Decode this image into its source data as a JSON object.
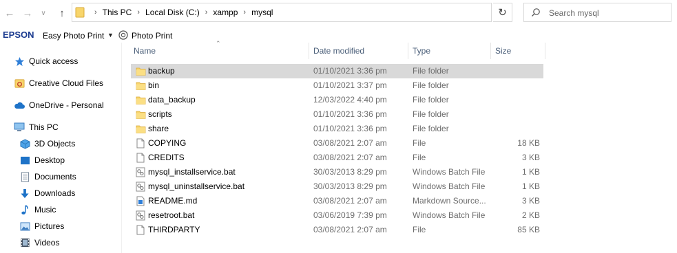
{
  "address_bar": {
    "crumbs": [
      "This PC",
      "Local Disk (C:)",
      "xampp",
      "mysql"
    ],
    "search_placeholder": "Search mysql"
  },
  "epson_toolbar": {
    "logo": "EPSON",
    "easy_photo_print": "Easy Photo Print",
    "photo_print": "Photo Print"
  },
  "sidebar": {
    "items": [
      {
        "label": "Quick access",
        "icon": "star-icon"
      },
      {
        "label": "Creative Cloud Files",
        "icon": "creative-cloud-icon"
      },
      {
        "label": "OneDrive - Personal",
        "icon": "cloud-icon"
      },
      {
        "label": "This PC",
        "icon": "computer-icon"
      },
      {
        "label": "3D Objects",
        "icon": "cube-icon"
      },
      {
        "label": "Desktop",
        "icon": "desktop-icon"
      },
      {
        "label": "Documents",
        "icon": "documents-icon"
      },
      {
        "label": "Downloads",
        "icon": "download-icon"
      },
      {
        "label": "Music",
        "icon": "music-icon"
      },
      {
        "label": "Pictures",
        "icon": "pictures-icon"
      },
      {
        "label": "Videos",
        "icon": "videos-icon"
      }
    ]
  },
  "columns": {
    "name": "Name",
    "date": "Date modified",
    "type": "Type",
    "size": "Size"
  },
  "files": [
    {
      "name": "backup",
      "date": "01/10/2021 3:36 pm",
      "type": "File folder",
      "size": "",
      "kind": "folder",
      "selected": true
    },
    {
      "name": "bin",
      "date": "01/10/2021 3:37 pm",
      "type": "File folder",
      "size": "",
      "kind": "folder"
    },
    {
      "name": "data_backup",
      "date": "12/03/2022 4:40 pm",
      "type": "File folder",
      "size": "",
      "kind": "folder"
    },
    {
      "name": "scripts",
      "date": "01/10/2021 3:36 pm",
      "type": "File folder",
      "size": "",
      "kind": "folder"
    },
    {
      "name": "share",
      "date": "01/10/2021 3:36 pm",
      "type": "File folder",
      "size": "",
      "kind": "folder"
    },
    {
      "name": "COPYING",
      "date": "03/08/2021 2:07 am",
      "type": "File",
      "size": "18 KB",
      "kind": "file"
    },
    {
      "name": "CREDITS",
      "date": "03/08/2021 2:07 am",
      "type": "File",
      "size": "3 KB",
      "kind": "file"
    },
    {
      "name": "mysql_installservice.bat",
      "date": "30/03/2013 8:29 pm",
      "type": "Windows Batch File",
      "size": "1 KB",
      "kind": "batch"
    },
    {
      "name": "mysql_uninstallservice.bat",
      "date": "30/03/2013 8:29 pm",
      "type": "Windows Batch File",
      "size": "1 KB",
      "kind": "batch"
    },
    {
      "name": "README.md",
      "date": "03/08/2021 2:07 am",
      "type": "Markdown Source...",
      "size": "3 KB",
      "kind": "markdown"
    },
    {
      "name": "resetroot.bat",
      "date": "03/06/2019 7:39 pm",
      "type": "Windows Batch File",
      "size": "2 KB",
      "kind": "batch"
    },
    {
      "name": "THIRDPARTY",
      "date": "03/08/2021 2:07 am",
      "type": "File",
      "size": "85 KB",
      "kind": "file"
    }
  ],
  "colors": {
    "folder": "#f8d56b",
    "selected_row": "#d9d9d9",
    "header_text": "#4c607a",
    "epson_blue": "#1a3a8f"
  }
}
